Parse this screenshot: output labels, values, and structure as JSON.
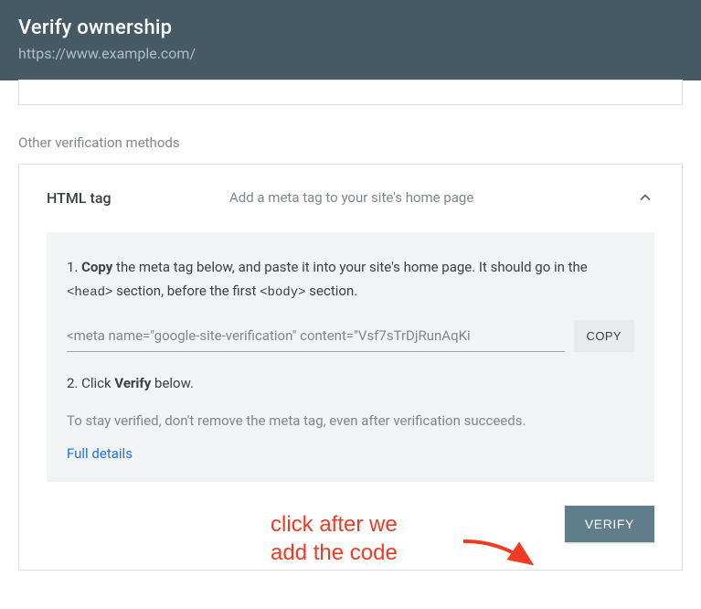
{
  "header": {
    "title": "Verify ownership",
    "url": "https://www.example.com/"
  },
  "section_label": "Other verification methods",
  "method": {
    "title": "HTML tag",
    "description": "Add a meta tag to your site's home page"
  },
  "instructions": {
    "step1_prefix": "1. ",
    "step1_bold": "Copy",
    "step1_a": " the meta tag below, and paste it into your site's home page. It should go in the ",
    "step1_head": "<head>",
    "step1_b": " section, before the first ",
    "step1_body": "<body>",
    "step1_c": " section.",
    "code": "<meta name=\"google-site-verification\" content=\"Vsf7sTrDjRunAqKi",
    "copy_label": "COPY",
    "step2_prefix": "2. Click ",
    "step2_bold": "Verify",
    "step2_suffix": " below.",
    "note": "To stay verified, don't remove the meta tag, even after verification succeeds.",
    "details_link": "Full details"
  },
  "verify_label": "VERIFY",
  "annotation": {
    "line1": "click after we",
    "line2": "add the code"
  }
}
